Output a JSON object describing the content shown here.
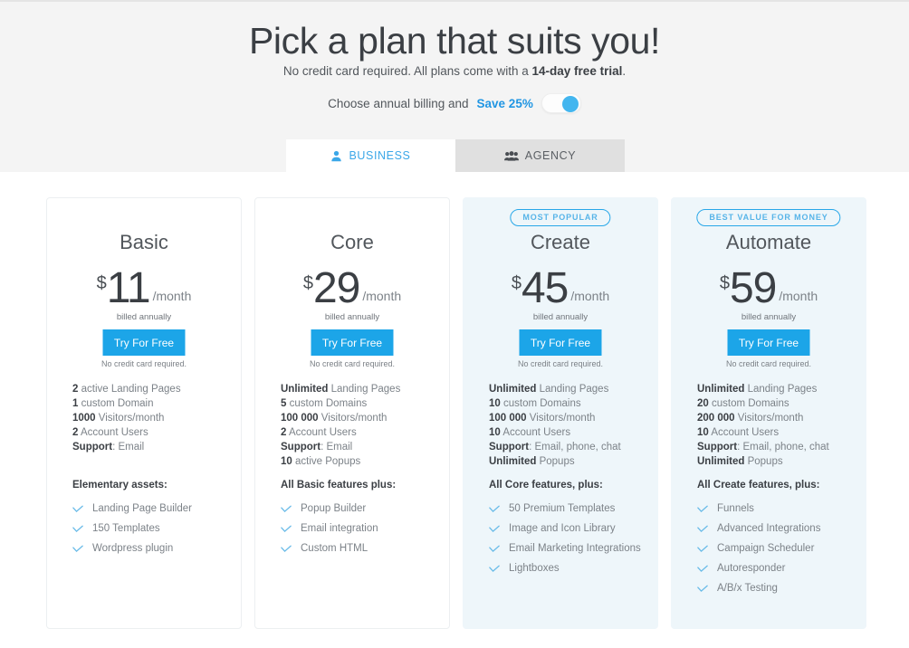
{
  "hero": {
    "title": "Pick a plan that suits you!",
    "subtitle_before": "No credit card required. All plans come with a ",
    "subtitle_bold": "14-day free trial",
    "subtitle_after": ".",
    "billing_label": "Choose annual billing and",
    "billing_save": "Save 25%",
    "toggle_state": "on"
  },
  "tabs": [
    {
      "label": "BUSINESS",
      "icon": "person-icon",
      "active": true
    },
    {
      "label": "AGENCY",
      "icon": "people-group-icon",
      "active": false
    }
  ],
  "colors": {
    "accent": "#1ca5e8",
    "badge_border": "#28a7e8",
    "featured_bg": "#eef6fa",
    "hero_bg": "#f4f4f4"
  },
  "common": {
    "cta_label": "Try For Free",
    "cta_note": "No credit card required.",
    "billed_note": "billed annually",
    "currency": "$",
    "per_month": "/month"
  },
  "plans": [
    {
      "name": "Basic",
      "badge": null,
      "price": "11",
      "featured": false,
      "specs": [
        {
          "bold": "2",
          "rest": " active Landing Pages"
        },
        {
          "bold": "1",
          "rest": " custom Domain"
        },
        {
          "bold": "1000",
          "rest": " Visitors/month"
        },
        {
          "bold": "2",
          "rest": " Account Users"
        },
        {
          "bold": "Support",
          "rest": ": Email"
        }
      ],
      "group_title": "Elementary assets:",
      "features": [
        "Landing Page Builder",
        "150 Templates",
        "Wordpress plugin"
      ]
    },
    {
      "name": "Core",
      "badge": null,
      "price": "29",
      "featured": false,
      "specs": [
        {
          "bold": "Unlimited",
          "rest": " Landing Pages"
        },
        {
          "bold": "5",
          "rest": " custom Domains"
        },
        {
          "bold": "100 000",
          "rest": " Visitors/month"
        },
        {
          "bold": "2",
          "rest": " Account Users"
        },
        {
          "bold": "Support",
          "rest": ": Email"
        },
        {
          "bold": "10",
          "rest": " active Popups"
        }
      ],
      "group_title": "All Basic features plus:",
      "features": [
        "Popup Builder",
        "Email integration",
        "Custom HTML"
      ]
    },
    {
      "name": "Create",
      "badge": "MOST POPULAR",
      "price": "45",
      "featured": true,
      "specs": [
        {
          "bold": "Unlimited",
          "rest": " Landing Pages"
        },
        {
          "bold": "10",
          "rest": " custom Domains"
        },
        {
          "bold": "100 000",
          "rest": " Visitors/month"
        },
        {
          "bold": "10",
          "rest": " Account Users"
        },
        {
          "bold": "Support",
          "rest": ": Email, phone, chat"
        },
        {
          "bold": "Unlimited",
          "rest": " Popups"
        }
      ],
      "group_title": "All Core features, plus:",
      "features": [
        "50 Premium Templates",
        "Image and Icon Library",
        "Email Marketing Integrations",
        "Lightboxes"
      ]
    },
    {
      "name": "Automate",
      "badge": "BEST VALUE FOR MONEY",
      "price": "59",
      "featured": true,
      "specs": [
        {
          "bold": "Unlimited",
          "rest": " Landing Pages"
        },
        {
          "bold": "20",
          "rest": " custom Domains"
        },
        {
          "bold": "200 000",
          "rest": " Visitors/month"
        },
        {
          "bold": "10",
          "rest": " Account Users"
        },
        {
          "bold": "Support",
          "rest": ": Email, phone, chat"
        },
        {
          "bold": "Unlimited",
          "rest": " Popups"
        }
      ],
      "group_title": "All Create features, plus:",
      "features": [
        "Funnels",
        "Advanced Integrations",
        "Campaign Scheduler",
        "Autoresponder",
        "A/B/x Testing"
      ]
    }
  ]
}
